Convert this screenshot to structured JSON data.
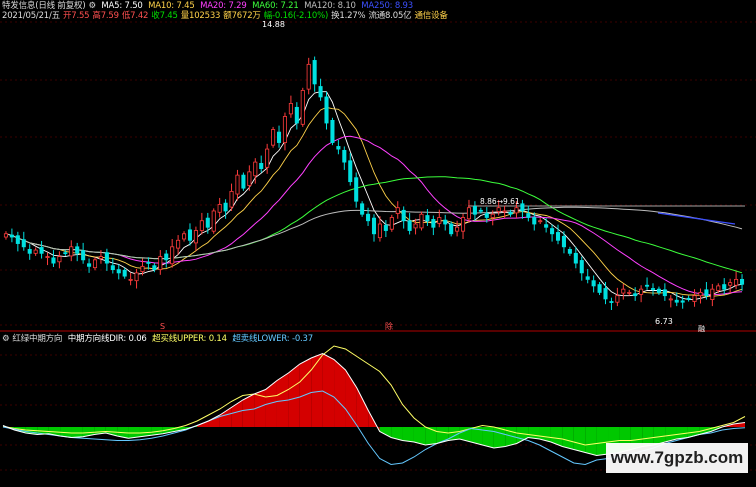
{
  "header_main": {
    "name": "特发信息(日线 前复权)",
    "ma5": "MA5: 7.50",
    "ma10": "MA10: 7.45",
    "ma20": "MA20: 7.29",
    "ma60": "MA60: 7.21",
    "ma120": "MA120: 8.10",
    "ma250": "MA250: 8.93"
  },
  "header_info": {
    "date": "2021/05/21/五",
    "open": "开7.55",
    "high": "高7.59",
    "low": "低7.42",
    "close": "收7.45",
    "volume": "量102533",
    "amount": "额7672万",
    "change": "幅-0.16(-2.10%)",
    "turnover": "换1.27%",
    "float_cap": "流通8.05亿",
    "sector": "通信设备"
  },
  "header_indicator": {
    "name": "红绿中期方向",
    "dir": "中期方向线DIR: 0.06",
    "upper": "超买线UPPER: 0.14",
    "lower": "超卖线LOWER: -0.37"
  },
  "price_labels": {
    "high": "14.88",
    "low": "6.73",
    "mid": "8.86→9.61"
  },
  "markers": {
    "m1": "S",
    "m2": "除",
    "m3": "融"
  },
  "watermark": "www.7gpzb.com",
  "colors": {
    "up": "#ff3c3c",
    "down": "#00e0e0",
    "ma5": "#ffffff",
    "ma10": "#ffd24a",
    "ma20": "#ff40ff",
    "ma60": "#3cff3c",
    "ma120": "#bdbdbd",
    "ma250": "#3c50ff",
    "dir": "#ffffff",
    "red_fill": "#d40000",
    "green_fill": "#00c800",
    "upper": "#ffff66",
    "lower": "#64c8ff",
    "grid": "#7a0000"
  },
  "chart_data": [
    {
      "type": "candlestick",
      "title": "特发信息(日线 前复权)",
      "ylim": [
        6.2,
        15.5
      ],
      "series_close": [
        9.0,
        8.9,
        8.7,
        8.6,
        8.4,
        8.5,
        8.4,
        8.3,
        8.1,
        8.3,
        8.4,
        8.6,
        8.4,
        8.2,
        8.0,
        8.2,
        8.3,
        8.1,
        7.9,
        7.8,
        7.7,
        7.6,
        7.8,
        8.0,
        8.1,
        7.9,
        8.3,
        8.2,
        8.6,
        8.8,
        9.0,
        8.8,
        9.1,
        9.4,
        9.2,
        9.7,
        9.9,
        9.7,
        10.3,
        10.8,
        10.4,
        10.9,
        11.2,
        11.0,
        11.6,
        12.2,
        11.8,
        12.6,
        13.0,
        12.4,
        13.4,
        14.2,
        13.6,
        13.2,
        12.4,
        11.8,
        11.6,
        11.2,
        10.6,
        10.0,
        9.6,
        9.4,
        9.0,
        9.3,
        9.1,
        9.5,
        9.8,
        9.4,
        9.1,
        9.3,
        9.6,
        9.4,
        9.2,
        9.5,
        9.3,
        9.0,
        9.2,
        9.5,
        9.8,
        9.6,
        9.7,
        9.5,
        9.6,
        9.8,
        9.7,
        9.6,
        9.8,
        9.7,
        9.5,
        9.3,
        9.4,
        9.2,
        9.0,
        8.8,
        8.6,
        8.4,
        8.1,
        7.8,
        7.6,
        7.4,
        7.2,
        7.0,
        6.9,
        7.1,
        7.3,
        7.2,
        7.1,
        7.3,
        7.4,
        7.3,
        7.2,
        7.1,
        7.0,
        6.9,
        6.9,
        7.0,
        7.1,
        7.2,
        7.1,
        7.3,
        7.4,
        7.3,
        7.5,
        7.6,
        7.45
      ]
    },
    {
      "type": "area",
      "title": "红绿中期方向",
      "series": [
        {
          "name": "中期方向线DIR",
          "values": [
            0.02,
            -0.04,
            -0.08,
            -0.1,
            -0.09,
            -0.12,
            -0.14,
            -0.13,
            -0.1,
            -0.08,
            -0.12,
            -0.15,
            -0.13,
            -0.11,
            -0.09,
            -0.06,
            -0.03,
            0.02,
            0.08,
            0.16,
            0.26,
            0.36,
            0.44,
            0.5,
            0.62,
            0.72,
            0.84,
            0.92,
            0.98,
            0.9,
            0.76,
            0.52,
            0.22,
            -0.06,
            -0.14,
            -0.18,
            -0.2,
            -0.24,
            -0.22,
            -0.18,
            -0.16,
            -0.2,
            -0.24,
            -0.28,
            -0.26,
            -0.22,
            -0.14,
            -0.16,
            -0.2,
            -0.26,
            -0.3,
            -0.34,
            -0.38,
            -0.36,
            -0.34,
            -0.3,
            -0.26,
            -0.24,
            -0.2,
            -0.16,
            -0.14,
            -0.1,
            -0.06,
            0.0,
            0.04,
            0.06
          ]
        },
        {
          "name": "超买线UPPER",
          "values": [
            0.01,
            -0.02,
            -0.04,
            -0.05,
            -0.06,
            -0.07,
            -0.08,
            -0.08,
            -0.07,
            -0.06,
            -0.07,
            -0.08,
            -0.08,
            -0.07,
            -0.05,
            -0.02,
            0.02,
            0.08,
            0.16,
            0.24,
            0.34,
            0.42,
            0.44,
            0.4,
            0.42,
            0.5,
            0.6,
            0.76,
            0.96,
            1.08,
            1.04,
            0.94,
            0.84,
            0.74,
            0.56,
            0.3,
            0.12,
            0.0,
            -0.06,
            -0.08,
            -0.06,
            -0.02,
            0.02,
            0.0,
            -0.04,
            -0.08,
            -0.1,
            -0.12,
            -0.14,
            -0.16,
            -0.2,
            -0.24,
            -0.22,
            -0.2,
            -0.18,
            -0.18,
            -0.16,
            -0.14,
            -0.12,
            -0.1,
            -0.08,
            -0.06,
            -0.02,
            0.02,
            0.06,
            0.14
          ]
        },
        {
          "name": "超卖线LOWER",
          "values": [
            0.0,
            -0.03,
            -0.06,
            -0.08,
            -0.1,
            -0.12,
            -0.14,
            -0.15,
            -0.16,
            -0.17,
            -0.18,
            -0.18,
            -0.17,
            -0.15,
            -0.12,
            -0.08,
            -0.04,
            0.02,
            0.08,
            0.14,
            0.18,
            0.22,
            0.24,
            0.3,
            0.34,
            0.36,
            0.4,
            0.46,
            0.48,
            0.4,
            0.24,
            0.02,
            -0.22,
            -0.42,
            -0.5,
            -0.48,
            -0.4,
            -0.3,
            -0.22,
            -0.16,
            -0.08,
            -0.02,
            -0.04,
            -0.06,
            -0.1,
            -0.14,
            -0.18,
            -0.24,
            -0.32,
            -0.4,
            -0.48,
            -0.5,
            -0.44,
            -0.42,
            -0.4,
            -0.36,
            -0.32,
            -0.28,
            -0.22,
            -0.18,
            -0.14,
            -0.1,
            -0.08,
            -0.04,
            -0.02,
            -0.01
          ]
        }
      ]
    }
  ]
}
